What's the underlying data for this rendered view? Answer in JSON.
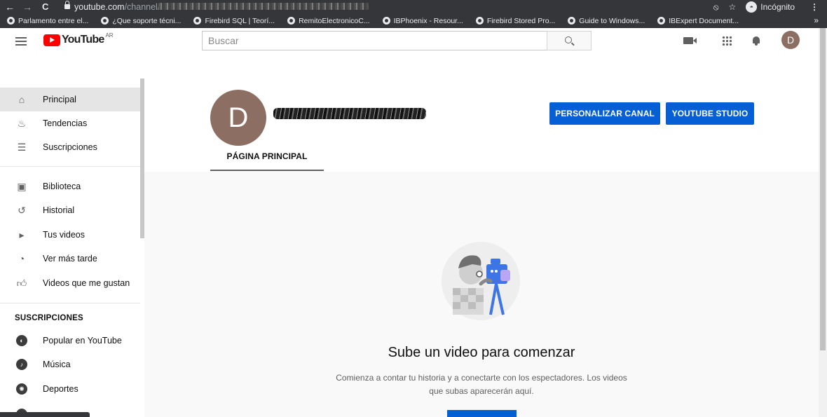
{
  "browser": {
    "url_host": "youtube.com",
    "url_rest": "/channel/",
    "incognito_label": "Incógnito",
    "bookmarks": [
      "Parlamento entre el...",
      "¿Que soporte técni...",
      "Firebird SQL | Teorí...",
      "RemitoElectronicoC...",
      "IBPhoenix - Resour...",
      "Firebird Stored Pro...",
      "Guide to Windows...",
      "IBExpert Document..."
    ],
    "bookmarks_more": "»"
  },
  "masthead": {
    "logo_text": "YouTube",
    "logo_region": "AR",
    "search_placeholder": "Buscar",
    "avatar_letter": "D"
  },
  "sidebar": {
    "main": [
      {
        "label": "Principal",
        "icon": "home-icon"
      },
      {
        "label": "Tendencias",
        "icon": "flame-icon"
      },
      {
        "label": "Suscripciones",
        "icon": "subscriptions-icon"
      }
    ],
    "library": [
      {
        "label": "Biblioteca",
        "icon": "library-icon"
      },
      {
        "label": "Historial",
        "icon": "history-icon"
      },
      {
        "label": "Tus videos",
        "icon": "your-videos-icon"
      },
      {
        "label": "Ver más tarde",
        "icon": "watch-later-icon"
      },
      {
        "label": "Videos que me gustan",
        "icon": "thumbs-up-icon"
      }
    ],
    "subscriptions_heading": "SUSCRIPCIONES",
    "subscriptions": [
      {
        "label": "Popular en YouTube",
        "icon": "popular-icon"
      },
      {
        "label": "Música",
        "icon": "music-icon"
      },
      {
        "label": "Deportes",
        "icon": "sports-icon"
      }
    ]
  },
  "channel": {
    "avatar_letter": "D",
    "customize_button": "PERSONALIZAR CANAL",
    "studio_button": "YOUTUBE STUDIO",
    "tab_home": "PÁGINA PRINCIPAL"
  },
  "empty_state": {
    "title": "Sube un video para comenzar",
    "description": "Comienza a contar tu historia y a conectarte con los espectadores. Los videos que subas aparecerán aquí."
  },
  "colors": {
    "accent_blue": "#065fd4",
    "avatar_brown": "#8d6e63",
    "logo_red": "#ff0000"
  }
}
